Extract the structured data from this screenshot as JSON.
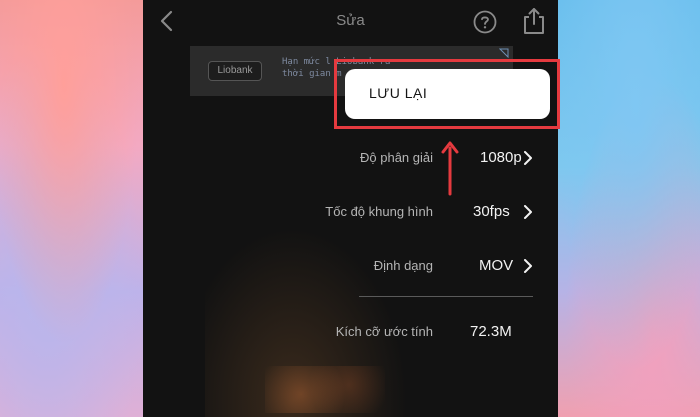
{
  "header": {
    "title": "Sửa"
  },
  "ad": {
    "logo": "Liobank",
    "text_line1": "Hạn mức l Liobank ra",
    "text_line2": "thời gian m"
  },
  "settings": [
    {
      "label": "Độ phân giải",
      "value": "1080p"
    },
    {
      "label": "Tốc độ khung hình",
      "value": "30fps"
    },
    {
      "label": "Định dạng",
      "value": "MOV"
    }
  ],
  "estimate": {
    "label": "Kích cỡ ước tính",
    "value": "72.3M"
  },
  "save_button": {
    "label": "LƯU LẠI"
  },
  "colors": {
    "highlight": "#e53a3f",
    "background_dark": "#121212"
  },
  "icons": [
    "back-icon",
    "help-icon",
    "share-icon",
    "chevron-right-icon",
    "ad-info-icon",
    "arrow-up-icon"
  ]
}
